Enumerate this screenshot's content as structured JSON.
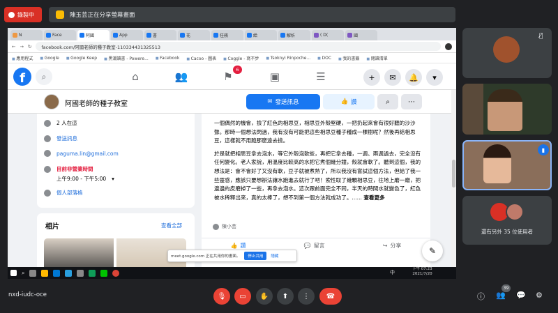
{
  "meet": {
    "recording_label": "錄製中",
    "presenting_text": "陳玉芸正在分享螢幕畫面",
    "meeting_code": "nxd-iudc-oce",
    "others_text": "還有另外 35 位使用者",
    "participant_count": "39"
  },
  "browser": {
    "tabs": [
      {
        "label": "N"
      },
      {
        "label": "Face"
      },
      {
        "label": "阿國"
      },
      {
        "label": "App"
      },
      {
        "label": "書"
      },
      {
        "label": "花"
      },
      {
        "label": "任務"
      },
      {
        "label": "給"
      },
      {
        "label": "解析"
      },
      {
        "label": "( D("
      },
      {
        "label": "國"
      }
    ],
    "url": "facebook.com/阿國老師的種子教室-110334431325513",
    "bookmarks": [
      "應用程式",
      "Google",
      "Google Keep",
      "黑潮讀書 - Powere...",
      "Facebook",
      "Cacoo - 圖表",
      "Coggle - 寫不步",
      "Tsoknyi Rinpoche...",
      "DOC",
      "我的書籤",
      "閱讀清單"
    ]
  },
  "facebook": {
    "notif_count": "6",
    "page_name": "阿國老師的種子教室",
    "message_button": "發送訊息",
    "like_button": "讚",
    "intro": {
      "discussing": "2 人在這",
      "send_message": "發送訊息",
      "email": "paguma.lin@gmail.com",
      "hours_status": "目前非營業時間",
      "hours": "上午9:00 - 下午5:00",
      "category": "個人部落格"
    },
    "photos_title": "相片",
    "photos_all": "查看全部",
    "post": {
      "p1": "一個偶然的機會，撿了紅色的相思豆，相思豆外殼堅硬，一把扔起來會有很好聽的沙沙聲。那時一個想法閃過，我有沒有可能把這些相思豆種子種成一棵樹呢？然後再結相思豆，這樣就不用跑那麼遠去撿。",
      "p2": "於是就把相思豆拿去泡水，等它外殼泡軟些，再把它拿去種，一週、兩週過去，完全沒有任何變化。老人家說，用溫度比較高的水把它煮個幾分鐘，殼就會軟了。聽到這個，我的想法是：會不會好了又沒有軟，豆子就被煮熟了，所以我沒有嘗試這個方法，但給了我一些靈感，應該只要想辦法讓水跑進去就行了吧！索性取了幾顆相思豆，往地上磨一磨，把邊邊的皮磨掉了一些，再拿去泡水。這次跟前面完全不同，半天的時間水就變色了，紅色被水稀釋出來，真的太棒了，想不到第一個方法就成功了。......",
      "see_more": "查看更多",
      "author": "陳小芸",
      "action_like": "讚",
      "action_comment": "留言",
      "action_share": "分享"
    }
  },
  "share_notice": {
    "text": "meet.google.com 正在共用你的畫面。",
    "stop": "停止共用",
    "hide": "隱藏"
  },
  "taskbar": {
    "ime": "中",
    "time": "下午 07:23",
    "date": "2021/7/20"
  }
}
